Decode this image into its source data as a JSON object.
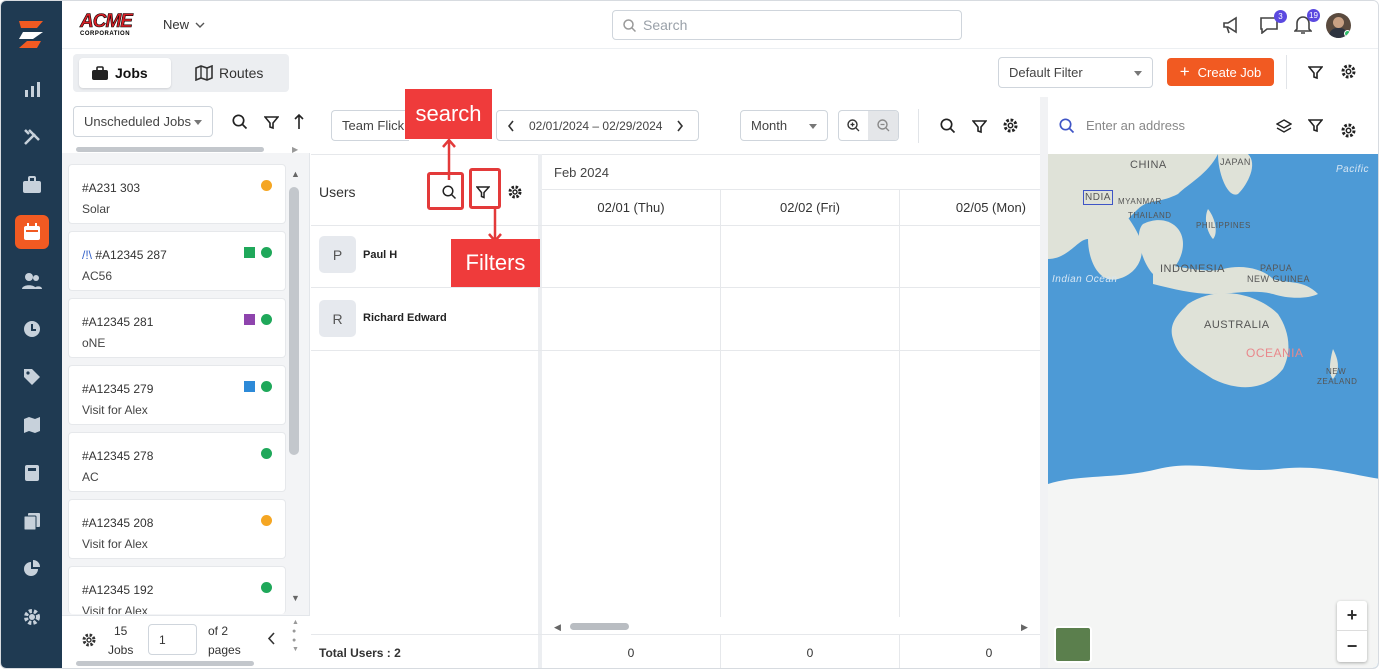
{
  "brand": {
    "logo_text": "ACME",
    "logo_subtext": "CORPORATION",
    "accent": "#f15a22",
    "rail_bg": "#1f3a52"
  },
  "header": {
    "new_label": "New",
    "search_placeholder": "Search",
    "messages_badge": "3",
    "notifications_badge": "19"
  },
  "rail": {
    "items": [
      "analytics-icon",
      "tools-icon",
      "briefcase-icon",
      "calendar-icon",
      "users-icon",
      "clock-icon",
      "tag-icon",
      "map-icon",
      "calculator-icon",
      "documents-icon",
      "pie-chart-icon",
      "settings-icon"
    ],
    "active": "calendar-icon"
  },
  "tabs": [
    {
      "label": "Jobs",
      "icon": "briefcase-icon"
    },
    {
      "label": "Routes",
      "icon": "map-icon"
    }
  ],
  "toolbar": {
    "default_filter": "Default Filter",
    "create_job": "Create Job"
  },
  "jobs_panel": {
    "filter": "Unscheduled Jobs",
    "cards": [
      {
        "id": "#A231 303",
        "sub": "Solar",
        "marks": [
          "orange"
        ]
      },
      {
        "id": "#A12345 287",
        "prefix": "/!\\",
        "sub": "AC56",
        "marks": [
          "green-square",
          "green"
        ]
      },
      {
        "id": "#A12345 281",
        "sub": "oNE",
        "marks": [
          "purple-square",
          "green"
        ]
      },
      {
        "id": "#A12345 279",
        "sub": "Visit for Alex",
        "marks": [
          "blue-square",
          "green"
        ]
      },
      {
        "id": "#A12345 278",
        "sub": "AC",
        "marks": [
          "green"
        ]
      },
      {
        "id": "#A12345 208",
        "sub": "Visit for Alex",
        "marks": [
          "orange"
        ]
      },
      {
        "id": "#A12345 192",
        "sub": "Visit for Alex",
        "marks": [
          "green"
        ]
      }
    ],
    "footer": {
      "count": "15",
      "count_label": "Jobs",
      "page_value": "1",
      "of_label": "of 2",
      "pages_label": "pages"
    }
  },
  "scheduler": {
    "team": "Team Flick",
    "date_range": "02/01/2024 – 02/29/2024",
    "view": "Month",
    "users_title": "Users",
    "month_label": "Feb 2024",
    "days": [
      "02/01 (Thu)",
      "02/02 (Fri)",
      "02/05 (Mon)"
    ],
    "users": [
      {
        "initial": "P",
        "name": "Paul H"
      },
      {
        "initial": "R",
        "name": "Richard Edward"
      }
    ],
    "total_label": "Total Users : 2",
    "totals": [
      "0",
      "0",
      "0"
    ]
  },
  "annotations": {
    "search": "search",
    "filters": "Filters",
    "color": "#ef3b3b"
  },
  "map": {
    "address_placeholder": "Enter an address",
    "labels": {
      "china": "CHINA",
      "japan": "JAPAN",
      "pacific": "Pacific",
      "india": "NDIA",
      "myanmar": "MYANMAR",
      "thailand": "THAILAND",
      "philippines": "PHILIPPINES",
      "indonesia": "INDONESIA",
      "papua": "PAPUA",
      "new_guinea": "NEW GUINEA",
      "indian_ocean": "Indian Ocean",
      "australia": "AUSTRALIA",
      "oceania": "OCEANIA",
      "new": "NEW",
      "zealand": "ZEALAND"
    },
    "zoom_in": "+",
    "zoom_out": "−"
  }
}
